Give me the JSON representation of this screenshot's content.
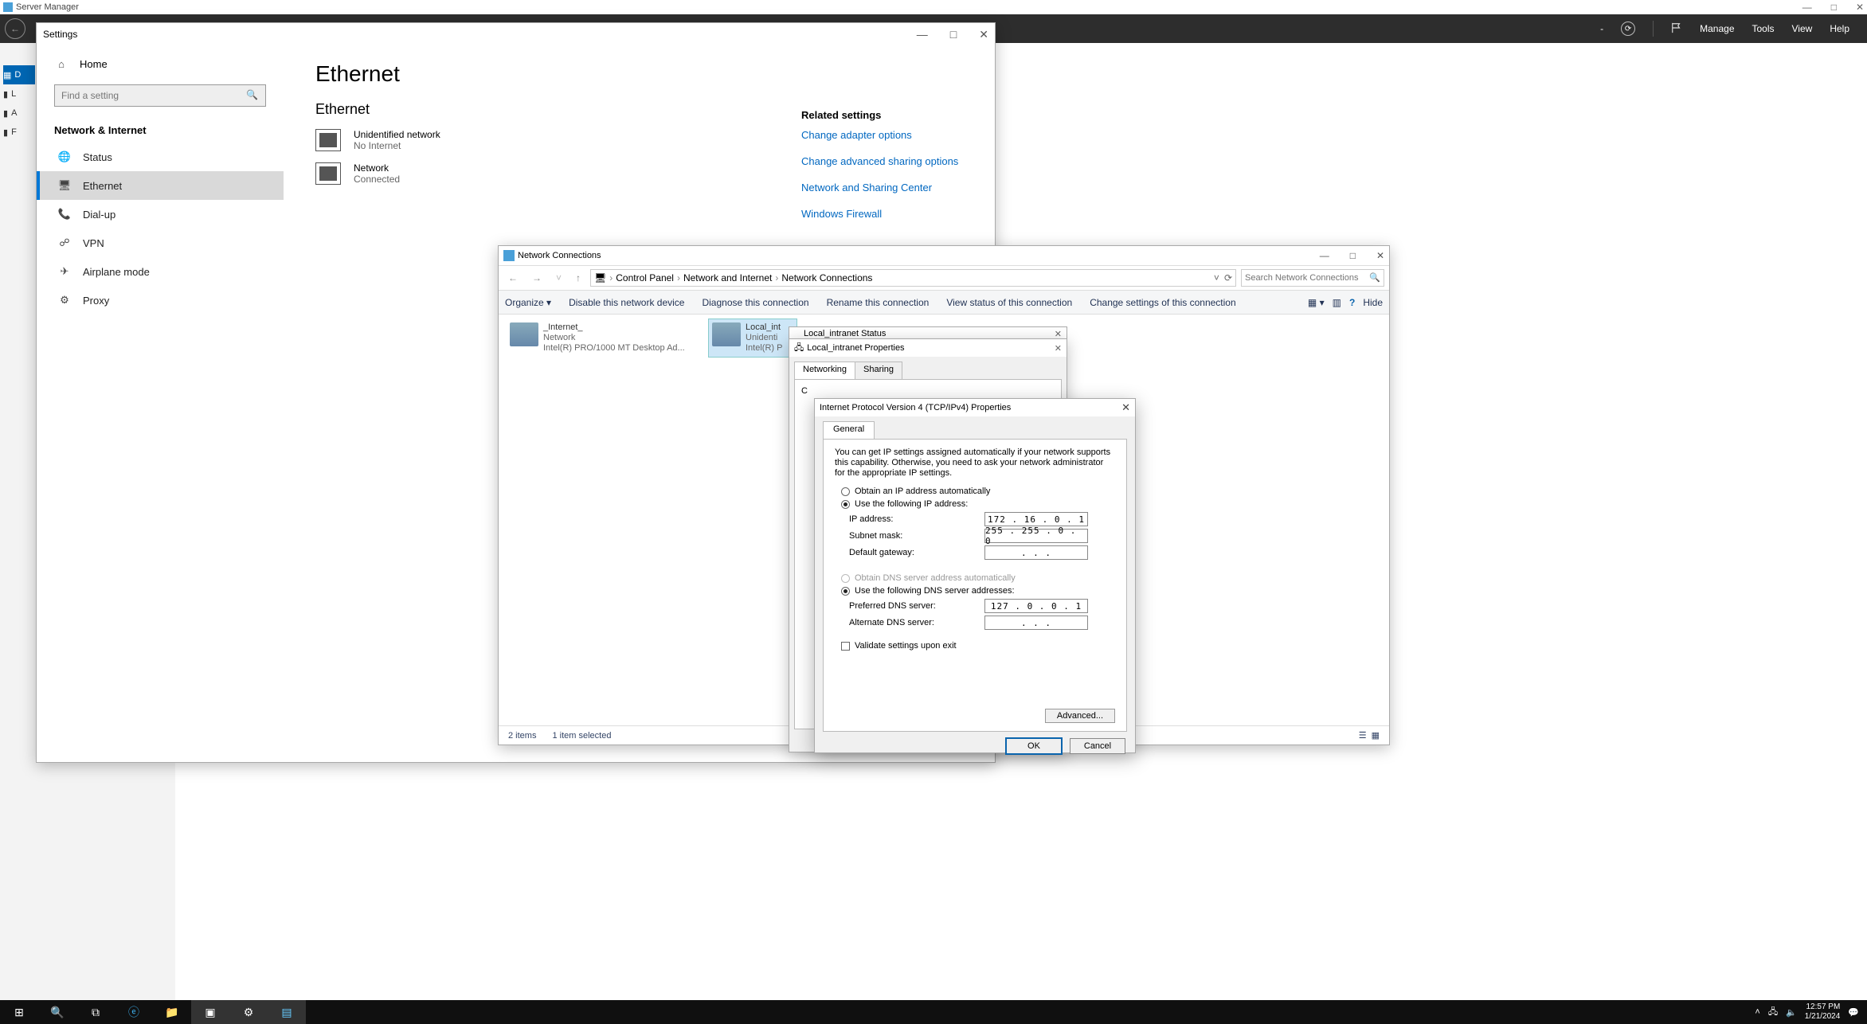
{
  "server_manager": {
    "title": "Server Manager",
    "menu": {
      "manage": "Manage",
      "tools": "Tools",
      "view": "View",
      "help": "Help"
    },
    "side": {
      "dash": "D",
      "local": "L",
      "all": "A",
      "file": "F"
    }
  },
  "settings": {
    "title": "Settings",
    "home": "Home",
    "search_placeholder": "Find a setting",
    "section": "Network & Internet",
    "items": {
      "status": "Status",
      "ethernet": "Ethernet",
      "dialup": "Dial-up",
      "vpn": "VPN",
      "airplane": "Airplane mode",
      "proxy": "Proxy"
    },
    "main": {
      "h1": "Ethernet",
      "h2": "Ethernet",
      "eth1_name": "Unidentified network",
      "eth1_sub": "No Internet",
      "eth2_name": "Network",
      "eth2_sub": "Connected"
    },
    "related": {
      "head": "Related settings",
      "l1": "Change adapter options",
      "l2": "Change advanced sharing options",
      "l3": "Network and Sharing Center",
      "l4": "Windows Firewall"
    }
  },
  "nc": {
    "title": "Network Connections",
    "crumb": {
      "cp": "Control Panel",
      "ni": "Network and Internet",
      "nc": "Network Connections"
    },
    "search_placeholder": "Search Network Connections",
    "cmd": {
      "organize": "Organize ▾",
      "disable": "Disable this network device",
      "diagnose": "Diagnose this connection",
      "rename": "Rename this connection",
      "viewstatus": "View status of this connection",
      "change": "Change settings of this connection",
      "hide": "Hide"
    },
    "adapters": {
      "a1": {
        "name": "_Internet_",
        "l2": "Network",
        "l3": "Intel(R) PRO/1000 MT Desktop Ad..."
      },
      "a2": {
        "name": "Local_int",
        "l2": "Unidenti",
        "l3": "Intel(R) P"
      }
    },
    "status": {
      "items": "2 items",
      "sel": "1 item selected"
    }
  },
  "status_stub": {
    "title": "Local_intranet Status"
  },
  "prop": {
    "title": "Local_intranet Properties",
    "tab1": "Networking",
    "tab2": "Sharing",
    "connect_label": "C"
  },
  "ipv4": {
    "title": "Internet Protocol Version 4 (TCP/IPv4) Properties",
    "tab": "General",
    "desc": "You can get IP settings assigned automatically if your network supports this capability. Otherwise, you need to ask your network administrator for the appropriate IP settings.",
    "r_auto_ip": "Obtain an IP address automatically",
    "r_use_ip": "Use the following IP address:",
    "ip_label": "IP address:",
    "ip_value": "172 . 16 .  0  .  1",
    "subnet_label": "Subnet mask:",
    "subnet_value": "255 . 255 .  0  .  0",
    "gateway_label": "Default gateway:",
    "gateway_value": " .       .       . ",
    "r_auto_dns": "Obtain DNS server address automatically",
    "r_use_dns": "Use the following DNS server addresses:",
    "pdns_label": "Preferred DNS server:",
    "pdns_value": "127 .  0  .  0  .  1",
    "adns_label": "Alternate DNS server:",
    "adns_value": " .       .       . ",
    "validate": "Validate settings upon exit",
    "advanced": "Advanced...",
    "ok": "OK",
    "cancel": "Cancel"
  },
  "taskbar": {
    "time": "12:57 PM",
    "date": "1/21/2024"
  }
}
